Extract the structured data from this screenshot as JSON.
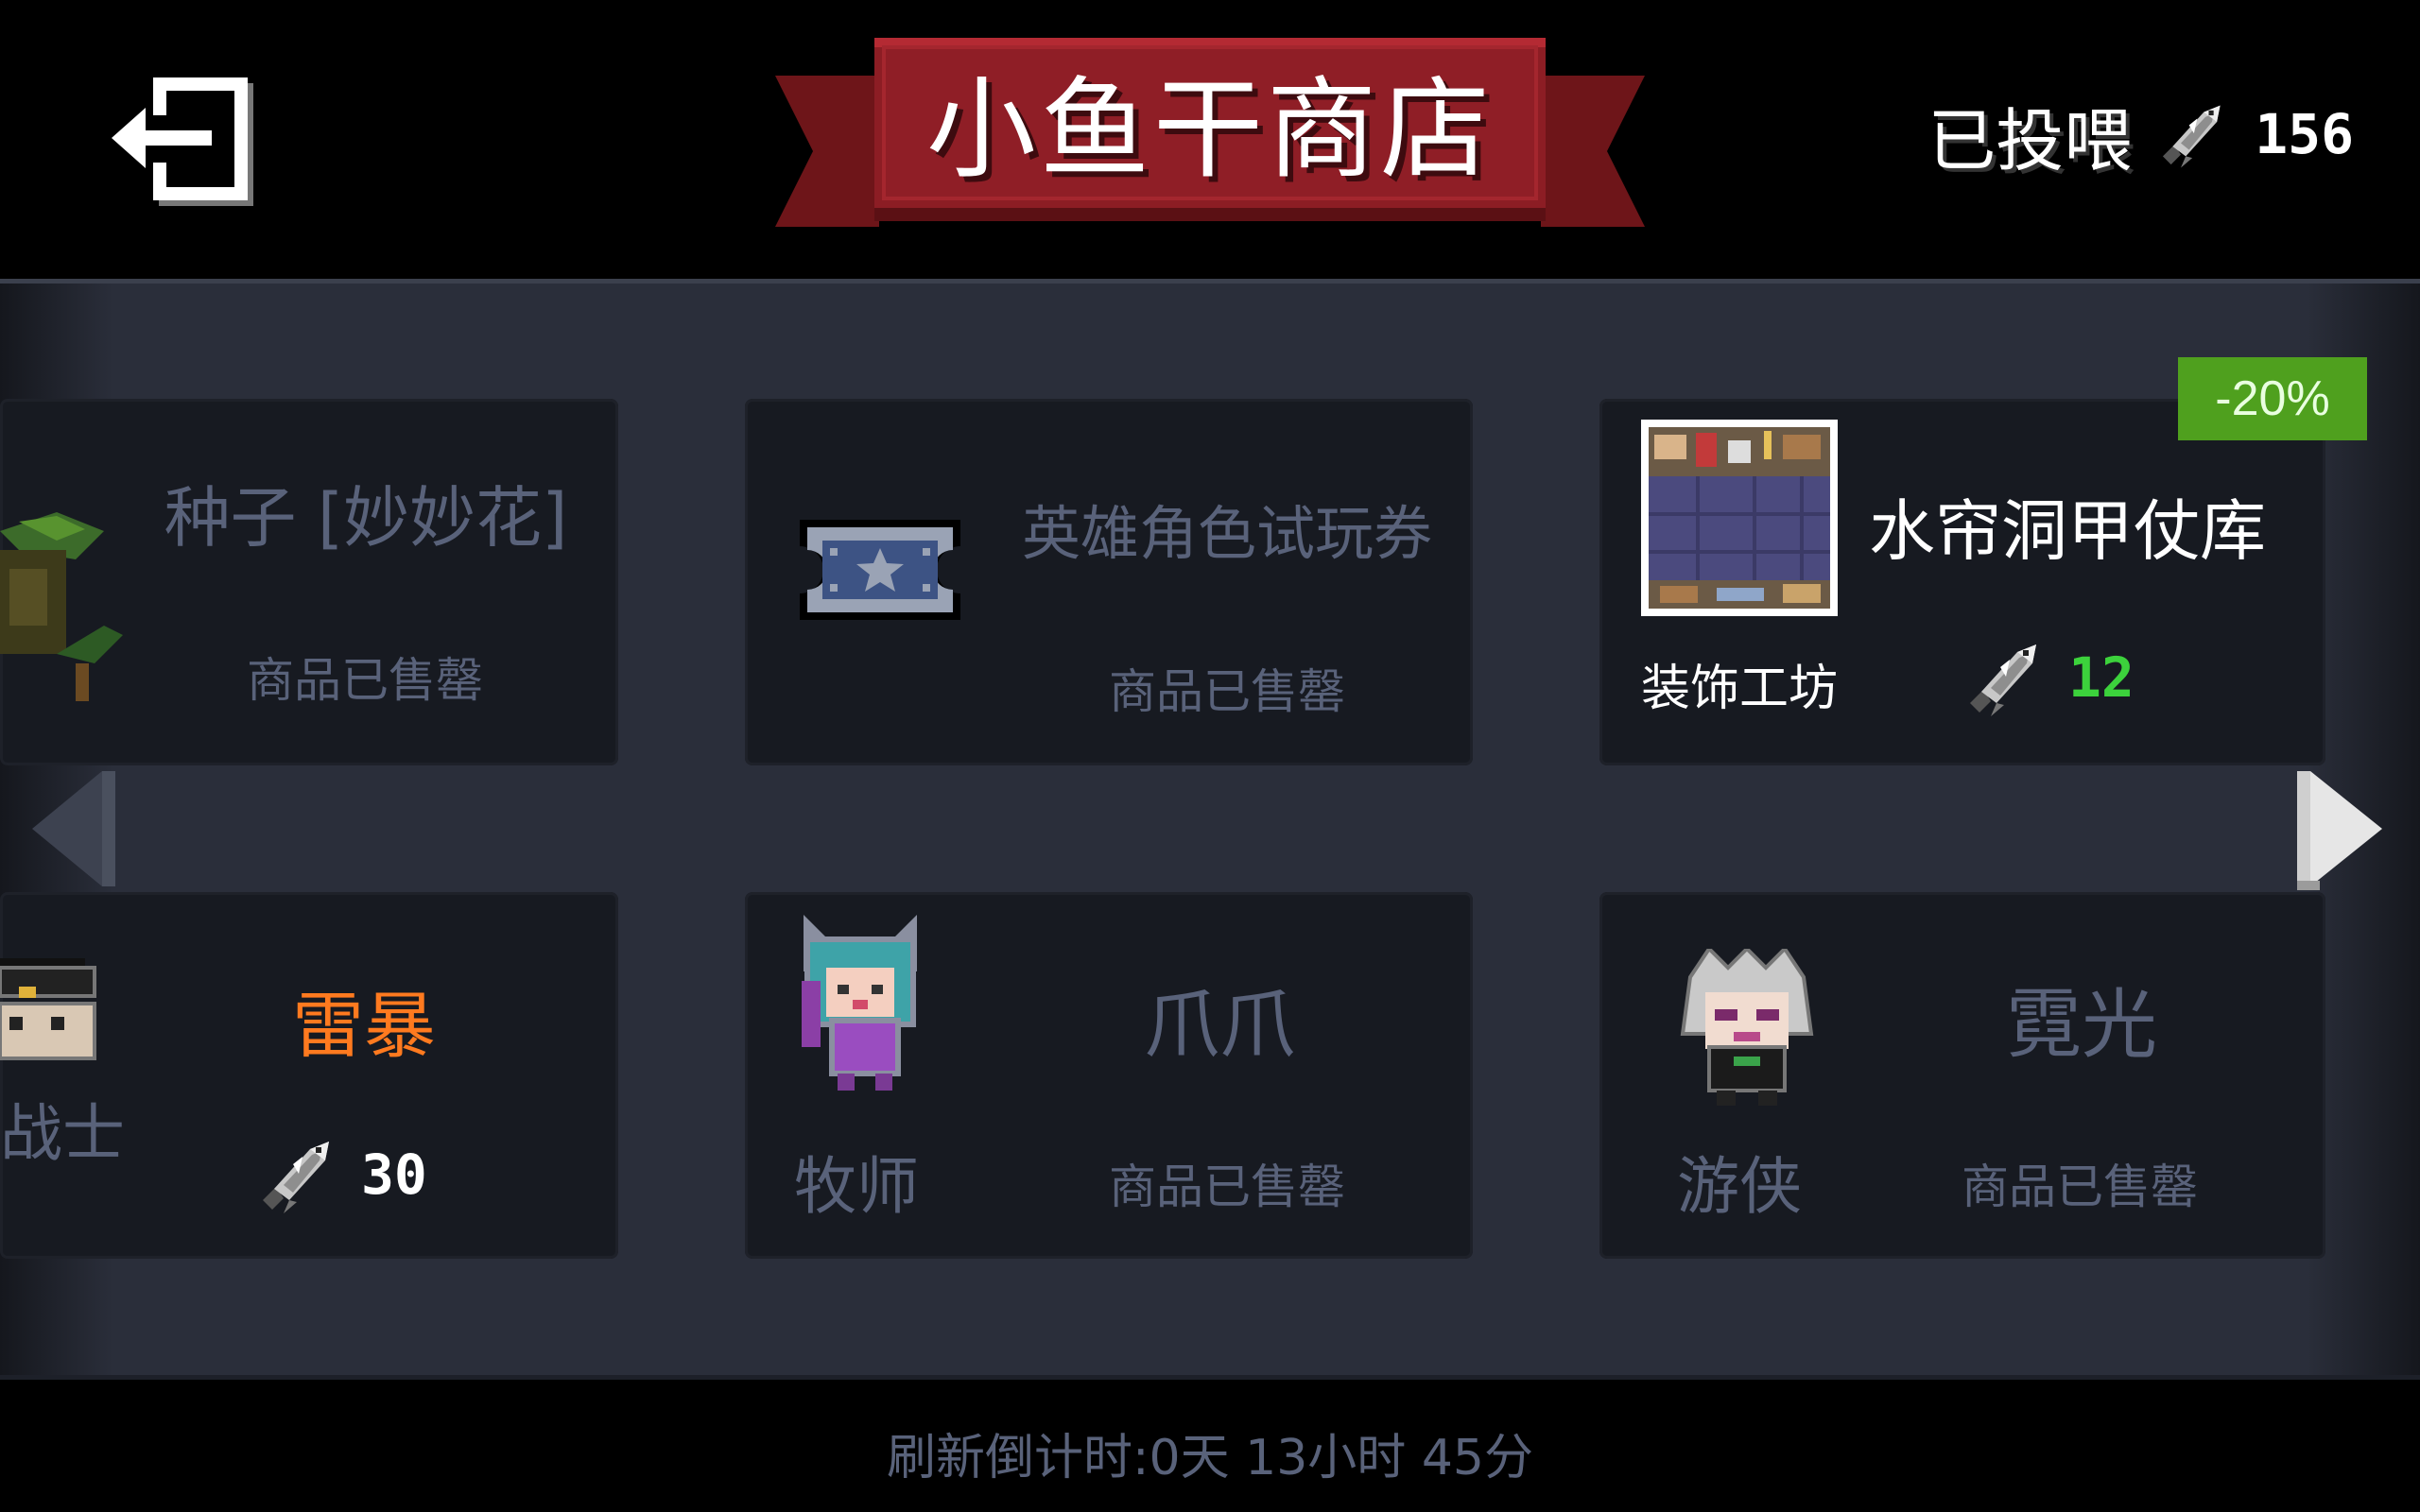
{
  "header": {
    "title": "小鱼干商店",
    "fed_label": "已投喂",
    "fed_count": "156"
  },
  "items": [
    {
      "title": "种子 [妙妙花]",
      "status": "商品已售罄"
    },
    {
      "title": "英雄角色试玩券",
      "status": "商品已售罄"
    },
    {
      "title": "水帘洞甲仗库",
      "category": "装饰工坊",
      "price": "12",
      "discount": "-20%"
    },
    {
      "title": "雷暴",
      "category": "战士",
      "price": "30"
    },
    {
      "title": "爪爪",
      "category": "牧师",
      "status": "商品已售罄"
    },
    {
      "title": "霓光",
      "category": "游侠",
      "status": "商品已售罄"
    }
  ],
  "footer": {
    "refresh_text": "刷新倒计时:0天 13小时 45分"
  },
  "colors": {
    "banner_red": "#8c1d24",
    "price_green": "#3cd23c",
    "highlight_orange": "#ff7a1f",
    "discount_green": "#4fa01e",
    "muted_text": "#59627a"
  },
  "icons": [
    "exit-icon",
    "fish-icon",
    "seed-plant-icon",
    "trial-ticket-icon",
    "armory-decoration-icon",
    "warrior-skin-icon",
    "priest-skin-icon",
    "ranger-skin-icon",
    "arrow-left-icon",
    "arrow-right-icon"
  ]
}
